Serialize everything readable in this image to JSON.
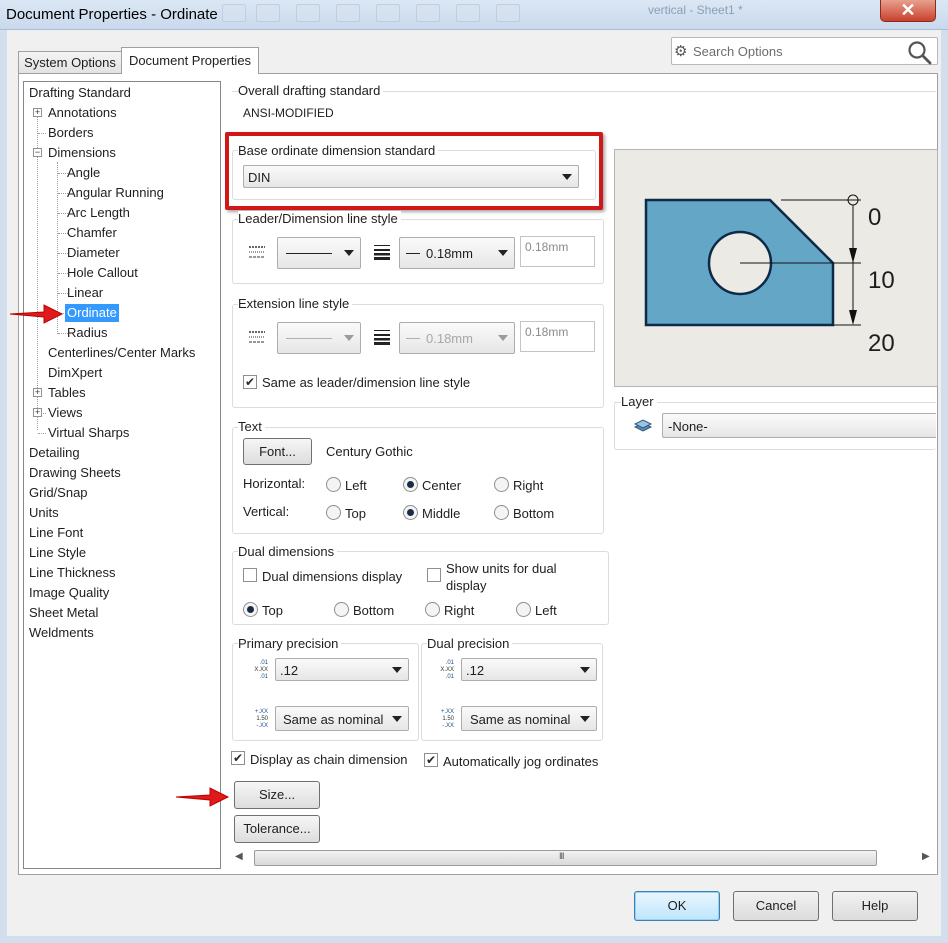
{
  "window": {
    "title": "Document Properties - Ordinate",
    "background_doc": "vertical - Sheet1 *"
  },
  "tabs": [
    {
      "label": "System Options"
    },
    {
      "label": "Document Properties"
    }
  ],
  "search": {
    "placeholder": "Search Options"
  },
  "tree": {
    "items": [
      {
        "label": "Drafting Standard"
      },
      {
        "label": "Annotations"
      },
      {
        "label": "Borders"
      },
      {
        "label": "Dimensions"
      },
      {
        "label": "Angle"
      },
      {
        "label": "Angular Running"
      },
      {
        "label": "Arc Length"
      },
      {
        "label": "Chamfer"
      },
      {
        "label": "Diameter"
      },
      {
        "label": "Hole Callout"
      },
      {
        "label": "Linear"
      },
      {
        "label": "Ordinate"
      },
      {
        "label": "Radius"
      },
      {
        "label": "Centerlines/Center Marks"
      },
      {
        "label": "DimXpert"
      },
      {
        "label": "Tables"
      },
      {
        "label": "Views"
      },
      {
        "label": "Virtual Sharps"
      },
      {
        "label": "Detailing"
      },
      {
        "label": "Drawing Sheets"
      },
      {
        "label": "Grid/Snap"
      },
      {
        "label": "Units"
      },
      {
        "label": "Line Font"
      },
      {
        "label": "Line Style"
      },
      {
        "label": "Line Thickness"
      },
      {
        "label": "Image Quality"
      },
      {
        "label": "Sheet Metal"
      },
      {
        "label": "Weldments"
      }
    ],
    "selected": "Ordinate"
  },
  "overall": {
    "label": "Overall drafting standard",
    "value": "ANSI-MODIFIED"
  },
  "base_ordinate": {
    "label": "Base ordinate dimension standard",
    "value": "DIN"
  },
  "leader_style": {
    "label": "Leader/Dimension line style",
    "thickness": "0.18mm",
    "custom": "0.18mm"
  },
  "extension_style": {
    "label": "Extension line style",
    "thickness": "0.18mm",
    "custom": "0.18mm",
    "same_as_label": "Same as leader/dimension line style",
    "same_as_checked": true
  },
  "text": {
    "label": "Text",
    "font_button": "Font...",
    "font_name": "Century Gothic",
    "horizontal_label": "Horizontal:",
    "vertical_label": "Vertical:",
    "horizontal": [
      {
        "label": "Left"
      },
      {
        "label": "Center"
      },
      {
        "label": "Right"
      }
    ],
    "vertical": [
      {
        "label": "Top"
      },
      {
        "label": "Middle"
      },
      {
        "label": "Bottom"
      }
    ],
    "horizontal_selected": "Center",
    "vertical_selected": "Middle"
  },
  "dual": {
    "label": "Dual dimensions",
    "display_label": "Dual dimensions display",
    "display_checked": false,
    "show_units_line1": "Show units for dual",
    "show_units_line2": "display",
    "show_units_checked": false,
    "positions": [
      {
        "label": "Top"
      },
      {
        "label": "Bottom"
      },
      {
        "label": "Right"
      },
      {
        "label": "Left"
      }
    ],
    "position_selected": "Top"
  },
  "primary_precision": {
    "label": "Primary precision",
    "value": ".12",
    "tolerance": "Same as nominal"
  },
  "dual_precision": {
    "label": "Dual precision",
    "value": ".12",
    "tolerance": "Same as nominal"
  },
  "precision_icons": {
    "value_top": ".01",
    "value_mid": "X.XX",
    "value_bot": ".01",
    "tol_top": "+.XX",
    "tol_mid": "1.50",
    "tol_bot": "-.XX"
  },
  "options": {
    "chain_label": "Display as chain dimension",
    "chain_checked": true,
    "jog_label": "Automatically jog ordinates",
    "jog_checked": true
  },
  "buttons": {
    "size": "Size...",
    "tolerance": "Tolerance...",
    "ok": "OK",
    "cancel": "Cancel",
    "help": "Help"
  },
  "preview": {
    "labels": [
      "0",
      "10",
      "20"
    ],
    "part_color": "#63a6c6",
    "background": "#ebeae4"
  },
  "layer": {
    "label": "Layer",
    "value": "-None-"
  },
  "scrollbar": {
    "grip": "III"
  },
  "accent": {
    "highlight": "#d01818",
    "selection": "#3399ff"
  }
}
